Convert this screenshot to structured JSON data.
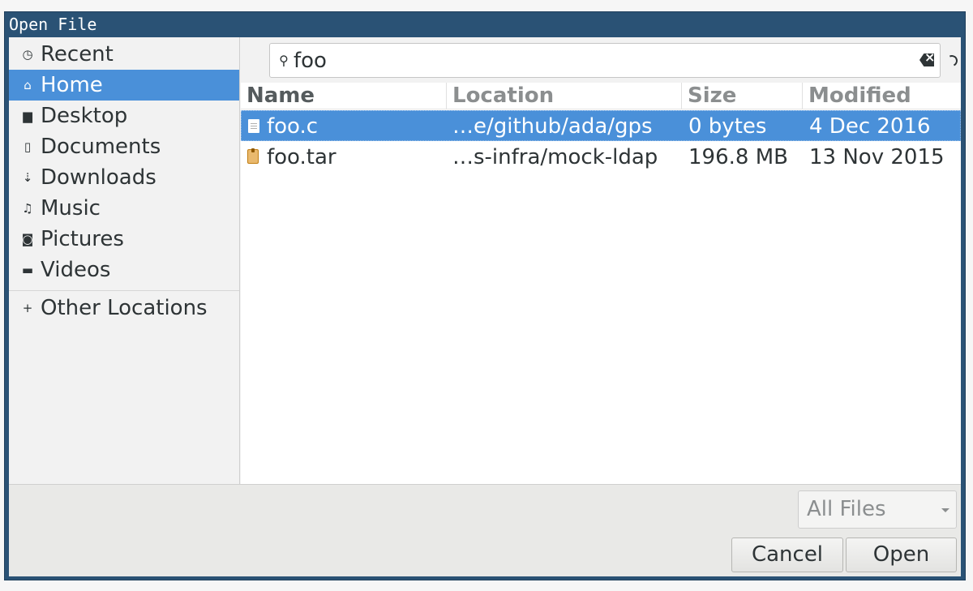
{
  "window": {
    "title": "Open File"
  },
  "sidebar": {
    "items": [
      {
        "label": "Recent",
        "icon": "clock-icon"
      },
      {
        "label": "Home",
        "icon": "home-icon",
        "selected": true
      },
      {
        "label": "Desktop",
        "icon": "folder-icon"
      },
      {
        "label": "Documents",
        "icon": "document-icon"
      },
      {
        "label": "Downloads",
        "icon": "download-icon"
      },
      {
        "label": "Music",
        "icon": "music-icon"
      },
      {
        "label": "Pictures",
        "icon": "camera-icon"
      },
      {
        "label": "Videos",
        "icon": "video-icon"
      }
    ],
    "other": {
      "label": "Other Locations",
      "icon": "plus-icon"
    }
  },
  "search": {
    "value": "foo"
  },
  "table": {
    "columns": [
      "Name",
      "Location",
      "Size",
      "Modified"
    ],
    "rows": [
      {
        "name": "foo.c",
        "location": "…e/github/ada/gps",
        "size": "0 bytes",
        "modified": "4 Dec 2016",
        "icon": "text-file-icon",
        "selected": true
      },
      {
        "name": "foo.tar",
        "location": "…s-infra/mock-ldap",
        "size": "196.8 MB",
        "modified": "13 Nov 2015",
        "icon": "archive-icon"
      }
    ]
  },
  "filter": {
    "selected": "All Files"
  },
  "buttons": {
    "cancel": "Cancel",
    "open": "Open"
  },
  "colors": {
    "titlebar": "#2a5275",
    "selection": "#4a90d9"
  }
}
